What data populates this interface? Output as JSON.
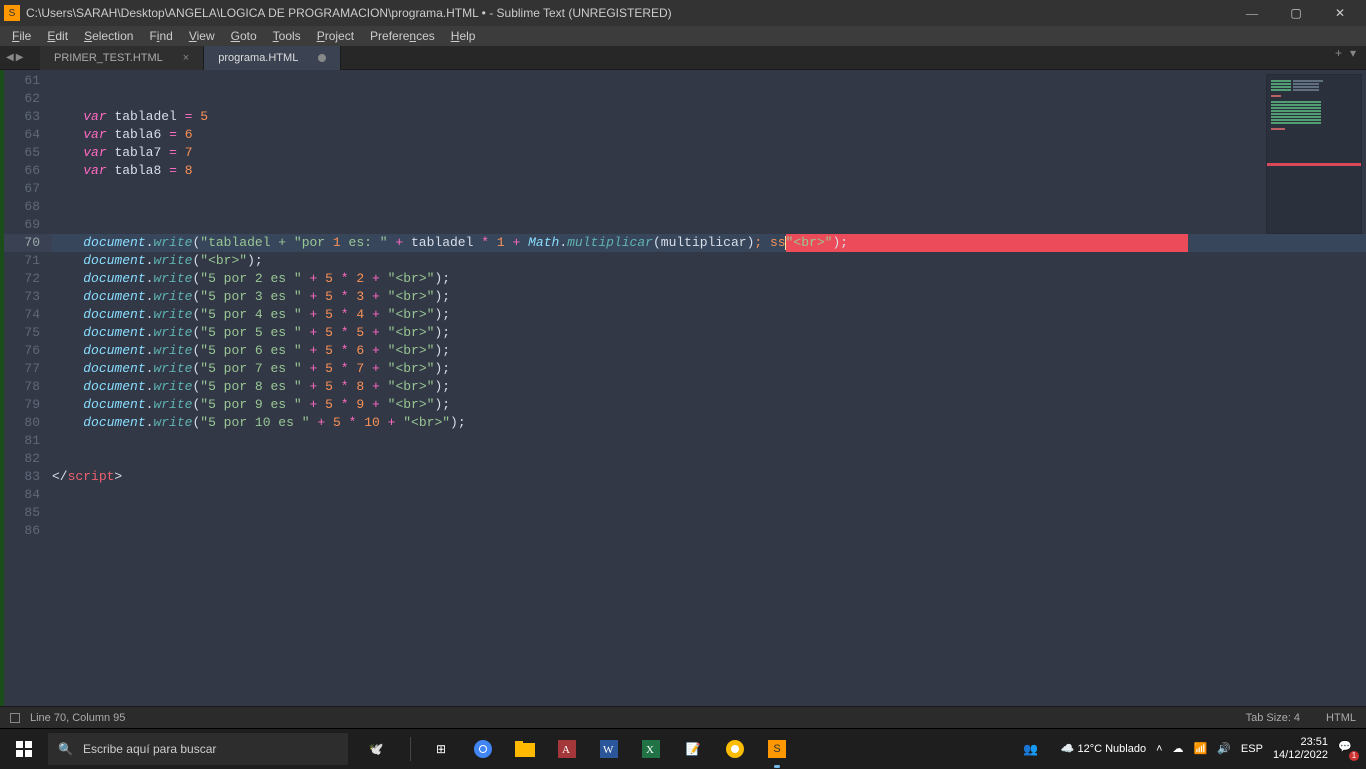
{
  "titlebar": {
    "title": "C:\\Users\\SARAH\\Desktop\\ANGELA\\LOGICA DE PROGRAMACION\\programa.HTML • - Sublime Text (UNREGISTERED)"
  },
  "menu": {
    "file": "File",
    "edit": "Edit",
    "selection": "Selection",
    "find": "Find",
    "view": "View",
    "goto": "Goto",
    "tools": "Tools",
    "project": "Project",
    "preferences": "Preferences",
    "help": "Help"
  },
  "tabs": {
    "t1": "PRIMER_TEST.HTML",
    "t2": "programa.HTML"
  },
  "lines": {
    "start": 61,
    "end": 86,
    "active": 70
  },
  "code": {
    "l61": "",
    "l62": "",
    "l63": {
      "kw": "var",
      "name": "tabladel",
      "op": "=",
      "val": "5"
    },
    "l64": {
      "kw": "var",
      "name": "tabla6",
      "op": "=",
      "val": "6"
    },
    "l65": {
      "kw": "var",
      "name": "tabla7",
      "op": "=",
      "val": "7"
    },
    "l66": {
      "kw": "var",
      "name": "tabla8",
      "op": "=",
      "val": "8"
    },
    "l70": {
      "obj": "document",
      "m": "write",
      "s1": "\"tabladel + \"",
      "s2": "por ",
      "n1": "1",
      "s3": " es: \"",
      "op1": "+",
      "v1": "tabladel",
      "op2": "*",
      "n2": "1",
      "op3": "+",
      "math": "Math",
      "mm": "multiplicar",
      "arg": "multiplicar",
      "tail": "; ss",
      "br": "\"<br>\"",
      "end": ");"
    },
    "l71": {
      "obj": "document",
      "m": "write",
      "str": "\"<br>\"",
      "end": ");"
    },
    "l72": {
      "obj": "document",
      "m": "write",
      "s1": "\"5 por 2 es \"",
      "op1": "+",
      "n1": "5",
      "op2": "*",
      "n2": "2",
      "op3": "+",
      "br": "\"<br>\"",
      "end": ");"
    },
    "l73": {
      "obj": "document",
      "m": "write",
      "s1": "\"5 por 3 es \"",
      "op1": "+",
      "n1": "5",
      "op2": "*",
      "n2": "3",
      "op3": "+",
      "br": "\"<br>\"",
      "end": ");"
    },
    "l74": {
      "obj": "document",
      "m": "write",
      "s1": "\"5 por 4 es \"",
      "op1": "+",
      "n1": "5",
      "op2": "*",
      "n2": "4",
      "op3": "+",
      "br": "\"<br>\"",
      "end": ");"
    },
    "l75": {
      "obj": "document",
      "m": "write",
      "s1": "\"5 por 5 es \"",
      "op1": "+",
      "n1": "5",
      "op2": "*",
      "n2": "5",
      "op3": "+",
      "br": "\"<br>\"",
      "end": ");"
    },
    "l76": {
      "obj": "document",
      "m": "write",
      "s1": "\"5 por 6 es \"",
      "op1": "+",
      "n1": "5",
      "op2": "*",
      "n2": "6",
      "op3": "+",
      "br": "\"<br>\"",
      "end": ");"
    },
    "l77": {
      "obj": "document",
      "m": "write",
      "s1": "\"5 por 7 es \"",
      "op1": "+",
      "n1": "5",
      "op2": "*",
      "n2": "7",
      "op3": "+",
      "br": "\"<br>\"",
      "end": ");"
    },
    "l78": {
      "obj": "document",
      "m": "write",
      "s1": "\"5 por 8 es \"",
      "op1": "+",
      "n1": "5",
      "op2": "*",
      "n2": "8",
      "op3": "+",
      "br": "\"<br>\"",
      "end": ");"
    },
    "l79": {
      "obj": "document",
      "m": "write",
      "s1": "\"5 por 9 es \"",
      "op1": "+",
      "n1": "5",
      "op2": "*",
      "n2": "9",
      "op3": "+",
      "br": "\"<br>\"",
      "end": ");"
    },
    "l80": {
      "obj": "document",
      "m": "write",
      "s1": "\"5 por 10 es \"",
      "op1": "+",
      "n1": "5",
      "op2": "*",
      "n2": "10",
      "op3": "+",
      "br": "\"<br>\"",
      "end": ");"
    },
    "l83": {
      "close": "</",
      "tag": "script",
      "gt": ">"
    }
  },
  "status": {
    "pos": "Line 70, Column 95",
    "tabsize": "Tab Size: 4",
    "lang": "HTML"
  },
  "taskbar": {
    "search_placeholder": "Escribe aquí para buscar",
    "weather": "12°C  Nublado",
    "lang": "ESP",
    "time": "23:51",
    "date": "14/12/2022"
  }
}
